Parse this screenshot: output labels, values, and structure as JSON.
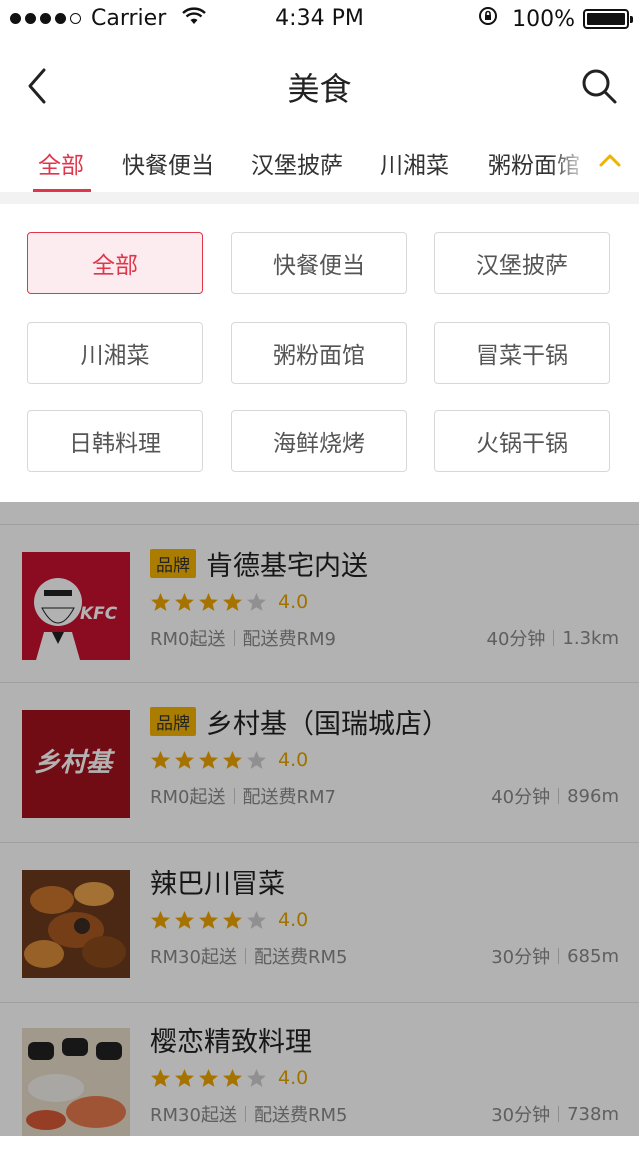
{
  "status_bar": {
    "carrier": "Carrier",
    "time": "4:34 PM",
    "battery": "100%"
  },
  "nav": {
    "title": "美食",
    "back_icon": "chevron-left-icon",
    "search_icon": "search-icon"
  },
  "tabs": {
    "items": [
      "全部",
      "快餐便当",
      "汉堡披萨",
      "川湘菜",
      "粥粉面馆"
    ],
    "active_index": 0,
    "collapse_icon": "chevron-up-icon",
    "collapse_color": "#f0b400"
  },
  "categories": [
    "全部",
    "快餐便当",
    "汉堡披萨",
    "川湘菜",
    "粥粉面馆",
    "冒菜干锅",
    "日韩料理",
    "海鲜烧烤",
    "火锅干锅"
  ],
  "colors": {
    "accent": "#e0364c",
    "star": "#f0a500",
    "brand_badge": "#f4b400"
  },
  "restaurants": [
    {
      "brand": "品牌",
      "name": "肯德基宅内送",
      "rating": 4.0,
      "rating_text": "4.0",
      "min_order": "RM0起送",
      "delivery_fee": "配送费RM9",
      "time": "40分钟",
      "distance": "1.3km",
      "logo_text": "KFC"
    },
    {
      "brand": "品牌",
      "name": "乡村基（国瑞城店）",
      "rating": 4.0,
      "rating_text": "4.0",
      "min_order": "RM0起送",
      "delivery_fee": "配送费RM7",
      "time": "40分钟",
      "distance": "896m",
      "logo_text": "乡村基"
    },
    {
      "brand": "",
      "name": "辣巴川冒菜",
      "rating": 4.0,
      "rating_text": "4.0",
      "min_order": "RM30起送",
      "delivery_fee": "配送费RM5",
      "time": "30分钟",
      "distance": "685m"
    },
    {
      "brand": "",
      "name": "樱恋精致料理",
      "rating": 4.0,
      "rating_text": "4.0",
      "min_order": "RM30起送",
      "delivery_fee": "配送费RM5",
      "time": "30分钟",
      "distance": "738m"
    }
  ]
}
